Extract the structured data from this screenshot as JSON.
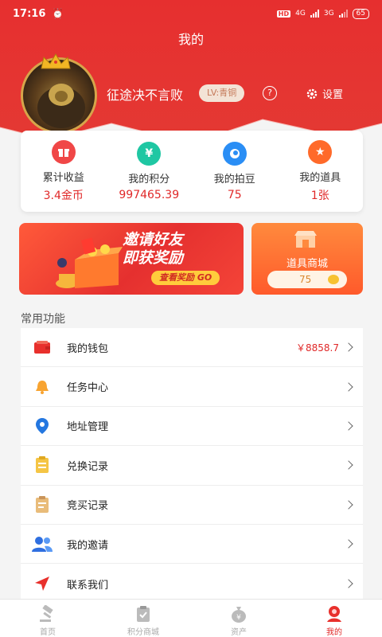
{
  "status_bar": {
    "time": "17:16",
    "network1": "4G",
    "network2": "3G",
    "battery": "65",
    "hd": "HD"
  },
  "header": {
    "title": "我的"
  },
  "profile": {
    "username": "征途决不言败",
    "level": "LV:青铜",
    "help": "?",
    "settings_label": "设置"
  },
  "stats": [
    {
      "label": "累计收益",
      "value": "3.4金币",
      "icon": "gift-icon",
      "color": "#f04747"
    },
    {
      "label": "我的积分",
      "value": "997465.39",
      "icon": "yen-icon",
      "color": "#1fc7a3"
    },
    {
      "label": "我的拍豆",
      "value": "75",
      "icon": "bean-icon",
      "color": "#2a8ef5"
    },
    {
      "label": "我的道具",
      "value": "1张",
      "icon": "star-icon",
      "color": "#ff6a2a"
    }
  ],
  "invite_banner": {
    "title_line1": "邀请好友",
    "title_line2": "即获奖励",
    "cta": "查看奖励 GO"
  },
  "shop_banner": {
    "label": "道具商城",
    "price": "75"
  },
  "menu": {
    "title": "常用功能",
    "items": [
      {
        "label": "我的钱包",
        "value": "￥8858.7",
        "icon": "wallet-icon"
      },
      {
        "label": "任务中心",
        "value": "",
        "icon": "bell-icon"
      },
      {
        "label": "地址管理",
        "value": "",
        "icon": "location-icon"
      },
      {
        "label": "兑换记录",
        "value": "",
        "icon": "exchange-record-icon"
      },
      {
        "label": "竞买记录",
        "value": "",
        "icon": "bid-record-icon"
      },
      {
        "label": "我的邀请",
        "value": "",
        "icon": "invite-users-icon"
      },
      {
        "label": "联系我们",
        "value": "",
        "icon": "send-icon"
      }
    ]
  },
  "bottom_nav": [
    {
      "label": "首页",
      "icon": "auction-hammer-icon",
      "active": false
    },
    {
      "label": "积分商城",
      "icon": "clipboard-check-icon",
      "active": false
    },
    {
      "label": "资产",
      "icon": "money-bag-icon",
      "active": false
    },
    {
      "label": "我的",
      "icon": "profile-icon",
      "active": true
    }
  ]
}
